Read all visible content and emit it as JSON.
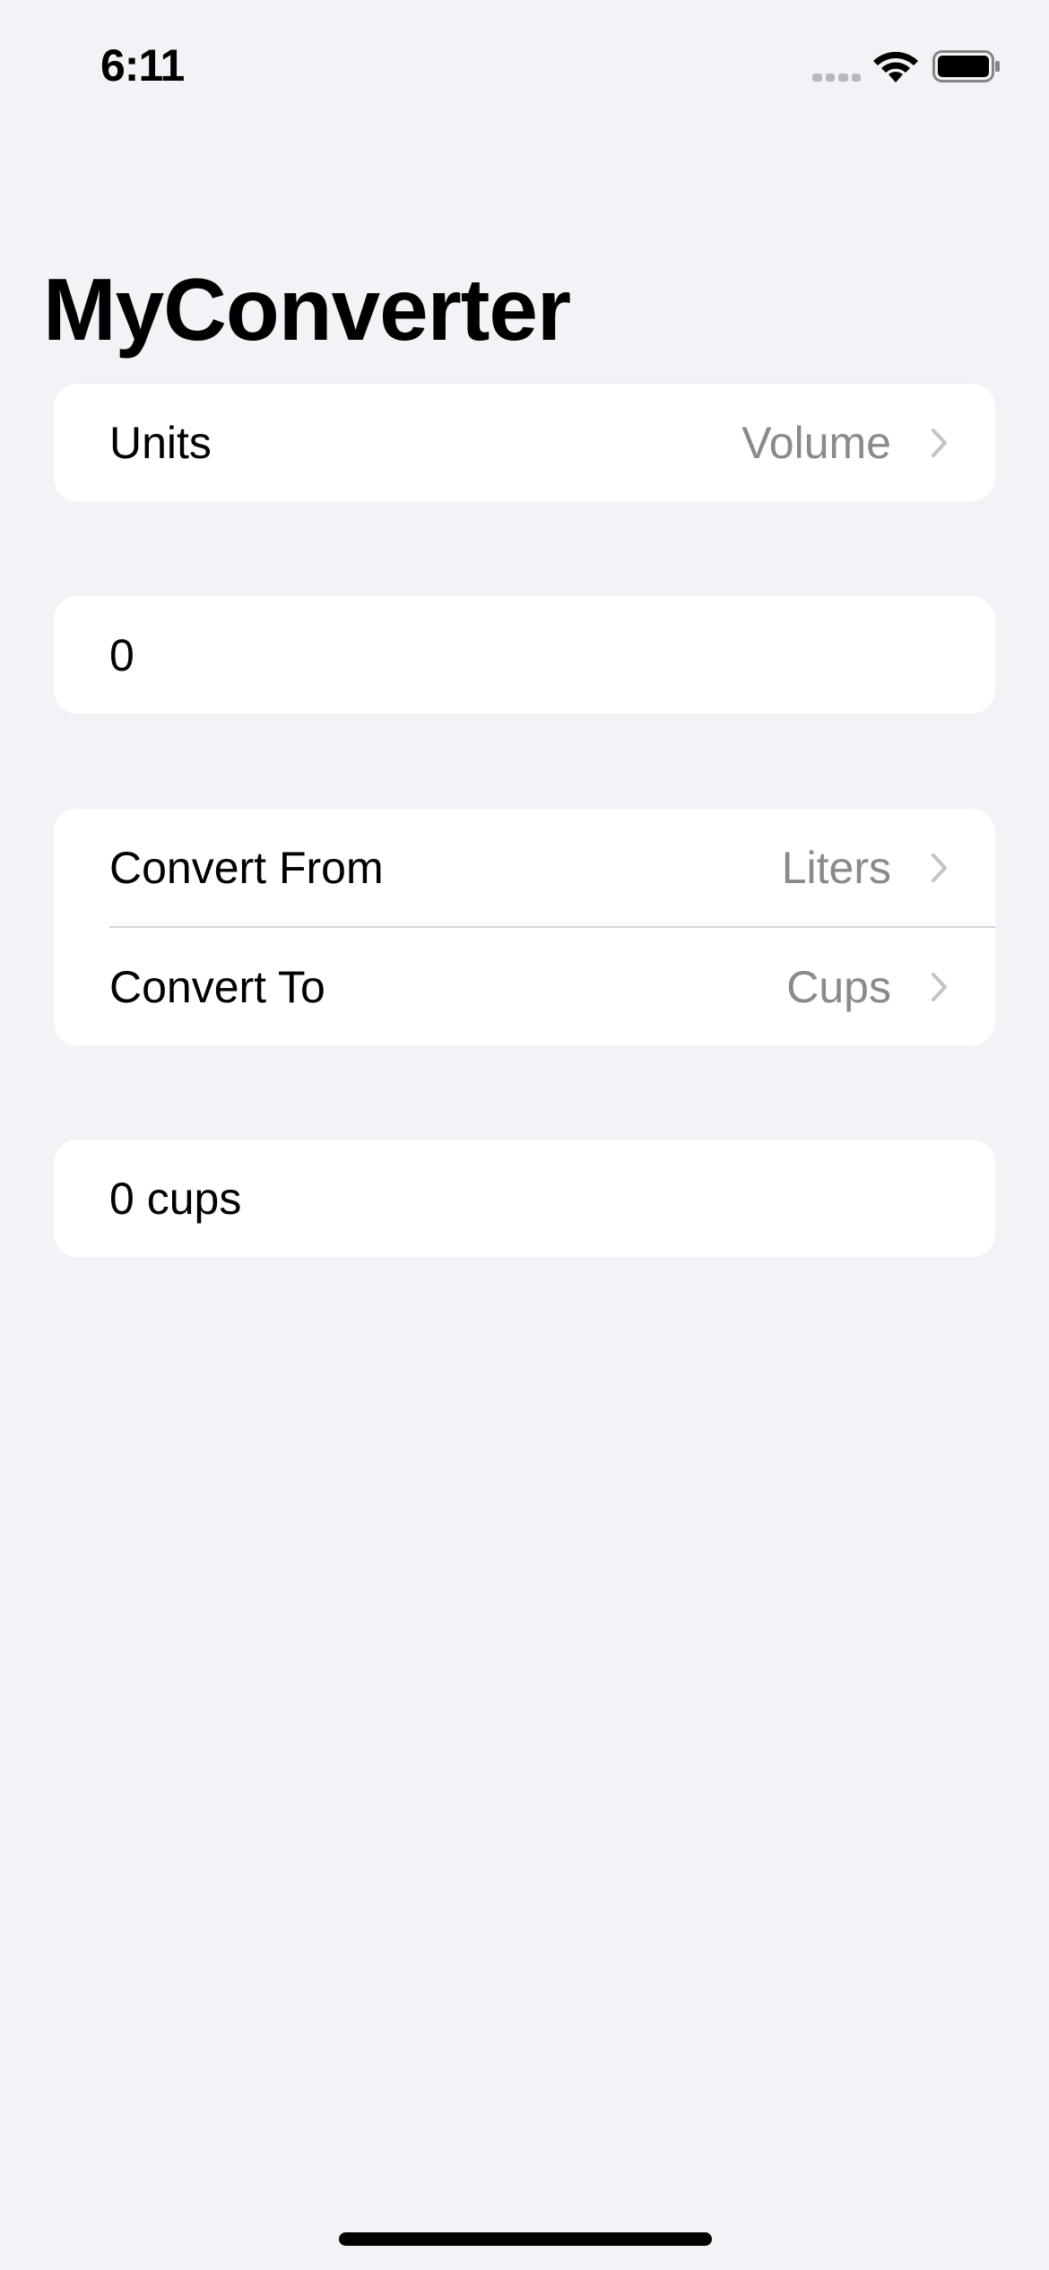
{
  "status_bar": {
    "time": "6:11"
  },
  "nav": {
    "title": "MyConverter"
  },
  "units_section": {
    "label": "Units",
    "value": "Volume"
  },
  "input_section": {
    "value": "0"
  },
  "conversion_section": {
    "from_label": "Convert From",
    "from_value": "Liters",
    "to_label": "Convert To",
    "to_value": "Cups"
  },
  "result_section": {
    "value": "0 cups"
  },
  "icons": {
    "chevron": "chevron-right-icon",
    "wifi": "wifi-icon",
    "battery": "battery-icon",
    "signal": "cellular-signal-icon"
  },
  "colors": {
    "background": "#f2f2f7",
    "card": "#ffffff",
    "secondary_text": "#8a8a8e",
    "chevron": "#c4c4c7"
  }
}
